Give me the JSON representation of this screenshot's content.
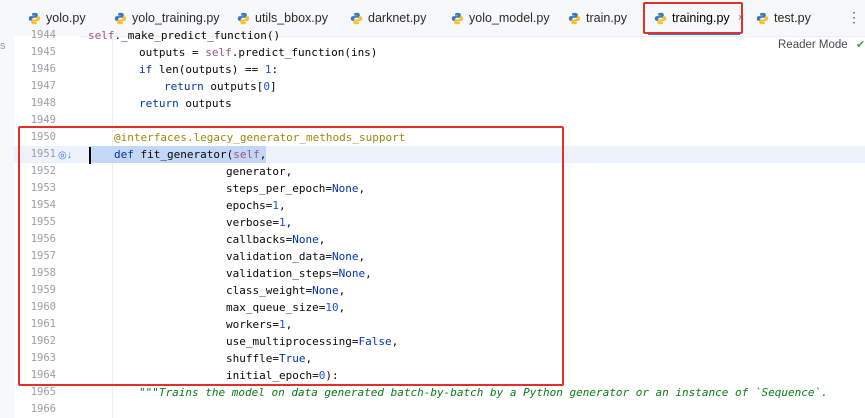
{
  "left_strip": {
    "fragment": "s"
  },
  "tabs": [
    {
      "label": "yolo.py",
      "active": false
    },
    {
      "label": "yolo_training.py",
      "active": false
    },
    {
      "label": "utils_bbox.py",
      "active": false
    },
    {
      "label": "darknet.py",
      "active": false
    },
    {
      "label": "yolo_model.py",
      "active": false
    },
    {
      "label": "train.py",
      "active": false
    },
    {
      "label": "training.py",
      "active": true
    },
    {
      "label": "test.py",
      "active": false
    }
  ],
  "tab_close_icon": "×",
  "more_icon": "⋮",
  "reader_mode": {
    "label": "Reader Mode",
    "check_icon": "✔"
  },
  "colors": {
    "highlight_box": "#e0302a",
    "keyword": "#0033b3",
    "number": "#1750eb",
    "decorator": "#9e880d",
    "docstring": "#067d17",
    "self": "#94558d"
  },
  "editor": {
    "lines": [
      {
        "num": "1944",
        "text": "        self._make_predict_function()"
      },
      {
        "num": "1945",
        "text": "        outputs = self.predict_function(ins)"
      },
      {
        "num": "1946",
        "text": "        if len(outputs) == 1:"
      },
      {
        "num": "1947",
        "text": "            return outputs[0]"
      },
      {
        "num": "1948",
        "text": "        return outputs"
      },
      {
        "num": "1949",
        "text": ""
      },
      {
        "num": "1950",
        "text": "    @interfaces.legacy_generator_methods_support"
      },
      {
        "num": "1951",
        "text": "    def fit_generator(self,"
      },
      {
        "num": "1952",
        "text": "                      generator,"
      },
      {
        "num": "1953",
        "text": "                      steps_per_epoch=None,"
      },
      {
        "num": "1954",
        "text": "                      epochs=1,"
      },
      {
        "num": "1955",
        "text": "                      verbose=1,"
      },
      {
        "num": "1956",
        "text": "                      callbacks=None,"
      },
      {
        "num": "1957",
        "text": "                      validation_data=None,"
      },
      {
        "num": "1958",
        "text": "                      validation_steps=None,"
      },
      {
        "num": "1959",
        "text": "                      class_weight=None,"
      },
      {
        "num": "1960",
        "text": "                      max_queue_size=10,"
      },
      {
        "num": "1961",
        "text": "                      workers=1,"
      },
      {
        "num": "1962",
        "text": "                      use_multiprocessing=False,"
      },
      {
        "num": "1963",
        "text": "                      shuffle=True,"
      },
      {
        "num": "1964",
        "text": "                      initial_epoch=0):"
      },
      {
        "num": "1965",
        "text": "        \"\"\"Trains the model on data generated batch-by-batch by a Python generator or an instance of `Sequence`."
      },
      {
        "num": "1966",
        "text": ""
      }
    ]
  }
}
